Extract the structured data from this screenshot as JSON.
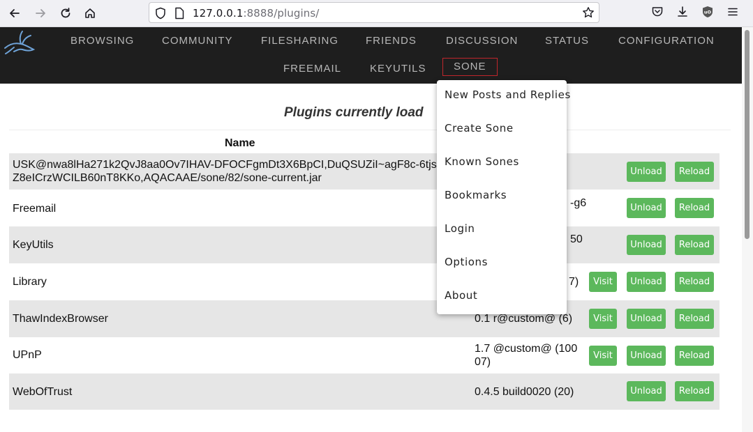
{
  "browser": {
    "url_host": "127.0.0.1",
    "url_rest": ":8888/plugins/"
  },
  "nav": {
    "row1": [
      "BROWSING",
      "COMMUNITY",
      "FILESHARING",
      "FRIENDS",
      "DISCUSSION",
      "STATUS",
      "CONFIGURATION"
    ],
    "row2": [
      "FREEMAIL",
      "KEYUTILS",
      "SONE"
    ],
    "active": "SONE",
    "active_color": "#c0262c"
  },
  "page": {
    "title": "Plugins currently load",
    "column_name": "Name"
  },
  "plugins": [
    {
      "name_line1": "USK@nwa8lHa271k2QvJ8aa0Ov7IHAV-DFOCFgmDt3X6BpCI,DuQSUZiI~agF8c-6tjs",
      "name_line2": "Z8eICrzWCILB60nT8KKo,AQACAAE/sone/82/sone-current.jar",
      "version": "",
      "unload": "Unload",
      "reload": "Reload"
    },
    {
      "name_line1": "Freemail",
      "version": "-g6",
      "unload": "Unload",
      "reload": "Reload"
    },
    {
      "name_line1": "KeyUtils",
      "version": "50",
      "unload": "Unload",
      "reload": "Reload"
    },
    {
      "name_line1": "Library",
      "version": "7)",
      "visit": "Visit",
      "unload": "Unload",
      "reload": "Reload"
    },
    {
      "name_line1": "ThawIndexBrowser",
      "version": "0.1 r@custom@ (6)",
      "visit": "Visit",
      "unload": "Unload",
      "reload": "Reload"
    },
    {
      "name_line1": "UPnP",
      "version": "1.7 @custom@ (100",
      "version_line2": "07)",
      "visit": "Visit",
      "unload": "Unload",
      "reload": "Reload"
    },
    {
      "name_line1": "WebOfTrust",
      "version": "0.4.5 build0020 (20)",
      "unload": "Unload",
      "reload": "Reload"
    }
  ],
  "sone_menu": [
    "New Posts and Replies",
    "Create Sone",
    "Known Sones",
    "Bookmarks",
    "Login",
    "Options",
    "About"
  ],
  "colors": {
    "header_bg": "#1e1e1e",
    "button_green": "#5cb85c",
    "row_shade": "#e6e6e6"
  }
}
